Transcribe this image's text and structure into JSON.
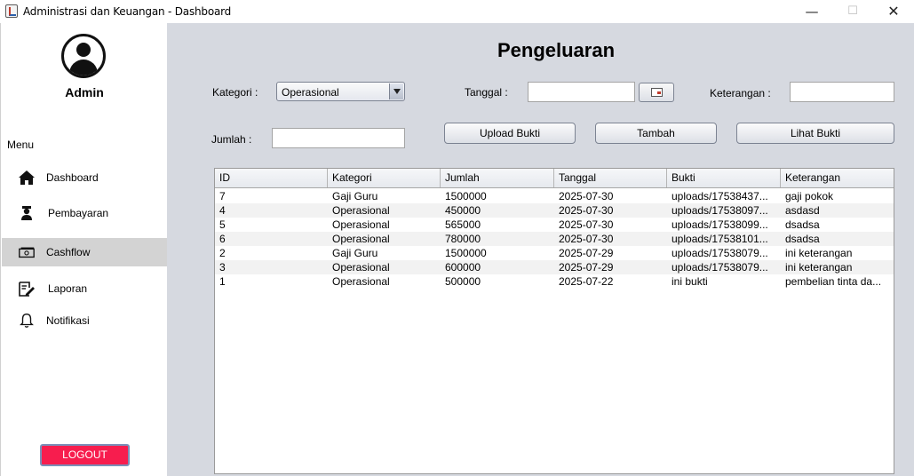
{
  "window": {
    "title": "Administrasi dan Keuangan - Dashboard",
    "minimize": "—",
    "maximize": "☐",
    "close": "✕"
  },
  "sidebar": {
    "user_name": "Admin",
    "menu_label": "Menu",
    "items": [
      {
        "label": "Dashboard",
        "icon": "home-icon",
        "active": false
      },
      {
        "label": "Pembayaran",
        "icon": "student-icon",
        "active": false
      },
      {
        "label": "Cashflow",
        "icon": "money-icon",
        "active": true
      },
      {
        "label": "Laporan",
        "icon": "edit-report-icon",
        "active": false
      },
      {
        "label": "Notifikasi",
        "icon": "bell-icon",
        "active": false
      }
    ],
    "logout_label": "LOGOUT"
  },
  "main": {
    "title": "Pengeluaran",
    "form": {
      "kategori_label": "Kategori :",
      "kategori_value": "Operasional",
      "tanggal_label": "Tanggal :",
      "tanggal_value": "",
      "keterangan_label": "Keterangan :",
      "keterangan_value": "",
      "jumlah_label": "Jumlah :",
      "jumlah_value": "",
      "upload_button": "Upload Bukti",
      "add_button": "Tambah",
      "view_button": "Lihat Bukti"
    },
    "table": {
      "columns": [
        "ID",
        "Kategori",
        "Jumlah",
        "Tanggal",
        "Bukti",
        "Keterangan"
      ],
      "rows": [
        [
          "7",
          "Gaji Guru",
          "1500000",
          "2025-07-30",
          "uploads/17538437...",
          "gaji pokok"
        ],
        [
          "4",
          "Operasional",
          "450000",
          "2025-07-30",
          "uploads/17538097...",
          "asdasd"
        ],
        [
          "5",
          "Operasional",
          "565000",
          "2025-07-30",
          "uploads/17538099...",
          "dsadsa"
        ],
        [
          "6",
          "Operasional",
          "780000",
          "2025-07-30",
          "uploads/17538101...",
          "dsadsa"
        ],
        [
          "2",
          "Gaji Guru",
          "1500000",
          "2025-07-29",
          "uploads/17538079...",
          "ini keterangan"
        ],
        [
          "3",
          "Operasional",
          "600000",
          "2025-07-29",
          "uploads/17538079...",
          "ini keterangan"
        ],
        [
          "1",
          "Operasional",
          "500000",
          "2025-07-22",
          "ini bukti",
          "pembelian tinta da..."
        ]
      ]
    }
  },
  "colors": {
    "main_bg": "#d6d9e0",
    "active_nav": "#d3d3d3",
    "logout": "#f71d4e"
  }
}
